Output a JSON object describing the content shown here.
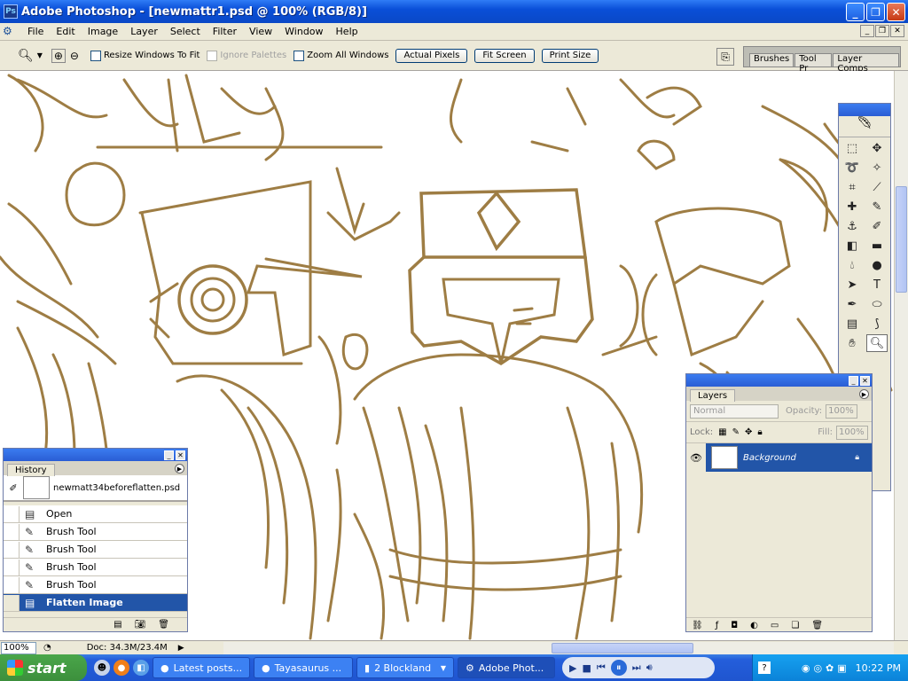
{
  "window": {
    "title": "Adobe Photoshop - [newmattr1.psd @ 100% (RGB/8)]"
  },
  "menu": [
    "File",
    "Edit",
    "Image",
    "Layer",
    "Select",
    "Filter",
    "View",
    "Window",
    "Help"
  ],
  "options": {
    "resize_windows": "Resize Windows To Fit",
    "ignore_palettes": "Ignore Palettes",
    "zoom_all_windows": "Zoom All Windows",
    "actual_pixels": "Actual Pixels",
    "fit_screen": "Fit Screen",
    "print_size": "Print Size"
  },
  "palette_well": {
    "tabs": [
      "Brushes",
      "Tool Pr",
      "Layer Comps"
    ]
  },
  "history": {
    "tab": "History",
    "snapshot": "newmatt34beforeflatten.psd",
    "items": [
      "Open",
      "Brush Tool",
      "Brush Tool",
      "Brush Tool",
      "Brush Tool",
      "Flatten Image"
    ]
  },
  "layers": {
    "tab": "Layers",
    "blend_mode": "Normal",
    "opacity_label": "Opacity:",
    "opacity_value": "100%",
    "lock_label": "Lock:",
    "fill_label": "Fill:",
    "fill_value": "100%",
    "layer_name": "Background"
  },
  "status": {
    "zoom": "100%",
    "doc": "Doc: 34.3M/23.4M"
  },
  "taskbar": {
    "start": "start",
    "buttons": [
      "Latest posts...",
      "Tayasaurus ...",
      "2 Blockland",
      "Adobe Phot..."
    ],
    "time": "10:22 PM"
  },
  "colors": {
    "sketch": "#9e7d44",
    "titlebar": "#0a4fd8",
    "selection": "#2255a8"
  }
}
